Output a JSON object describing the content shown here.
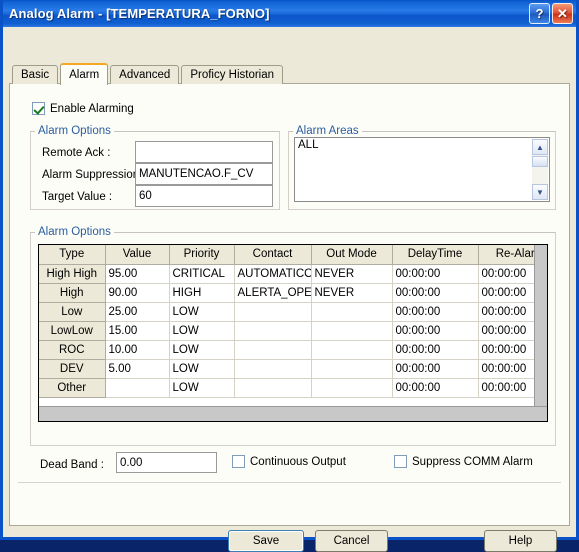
{
  "window": {
    "title": "Analog Alarm - [TEMPERATURA_FORNO]",
    "help_button": "?",
    "close_button": "✕",
    "titlebar_color": "#1b6bdd"
  },
  "tabs": [
    {
      "label": "Basic",
      "active": false
    },
    {
      "label": "Alarm",
      "active": true
    },
    {
      "label": "Advanced",
      "active": false
    },
    {
      "label": "Proficy Historian",
      "active": false
    }
  ],
  "enable_alarming": {
    "label": "Enable Alarming",
    "checked": true
  },
  "alarm_options_group": {
    "legend": "Alarm Options",
    "fields": [
      {
        "label": "Remote Ack :",
        "value": ""
      },
      {
        "label": "Alarm Suppression :",
        "value": "MANUTENCAO.F_CV"
      },
      {
        "label": "Target Value :",
        "value": "60"
      }
    ]
  },
  "alarm_areas_group": {
    "legend": "Alarm Areas",
    "items": [
      "ALL"
    ],
    "scroll_up_icon": "▲",
    "scroll_down_icon": "▼"
  },
  "alarm_table_group": {
    "legend": "Alarm Options",
    "columns": [
      "Type",
      "Value",
      "Priority",
      "Contact",
      "Out Mode",
      "DelayTime",
      "Re-Alarm"
    ],
    "rows": [
      {
        "type": "High High",
        "value": "95.00",
        "priority": "CRITICAL",
        "contact": "AUTOMATICO.",
        "out_mode": "NEVER",
        "delay_time": "00:00:00",
        "re_alarm": "00:00:00"
      },
      {
        "type": "High",
        "value": "90.00",
        "priority": "HIGH",
        "contact": "ALERTA_OPER",
        "out_mode": "NEVER",
        "delay_time": "00:00:00",
        "re_alarm": "00:00:00"
      },
      {
        "type": "Low",
        "value": "25.00",
        "priority": "LOW",
        "contact": "",
        "out_mode": "",
        "delay_time": "00:00:00",
        "re_alarm": "00:00:00"
      },
      {
        "type": "LowLow",
        "value": "15.00",
        "priority": "LOW",
        "contact": "",
        "out_mode": "",
        "delay_time": "00:00:00",
        "re_alarm": "00:00:00"
      },
      {
        "type": "ROC",
        "value": "10.00",
        "priority": "LOW",
        "contact": "",
        "out_mode": "",
        "delay_time": "00:00:00",
        "re_alarm": "00:00:00"
      },
      {
        "type": "DEV",
        "value": "5.00",
        "priority": "LOW",
        "contact": "",
        "out_mode": "",
        "delay_time": "00:00:00",
        "re_alarm": "00:00:00"
      },
      {
        "type": "Other",
        "value": "",
        "priority": "LOW",
        "contact": "",
        "out_mode": "",
        "delay_time": "00:00:00",
        "re_alarm": "00:00:00"
      }
    ]
  },
  "bottom_row": {
    "dead_band_label": "Dead Band :",
    "dead_band_value": "0.00",
    "continuous_output_label": "Continuous Output",
    "continuous_output_checked": false,
    "suppress_comm_label": "Suppress COMM Alarm",
    "suppress_comm_checked": false
  },
  "footer_buttons": {
    "save": "Save",
    "cancel": "Cancel",
    "help": "Help"
  }
}
